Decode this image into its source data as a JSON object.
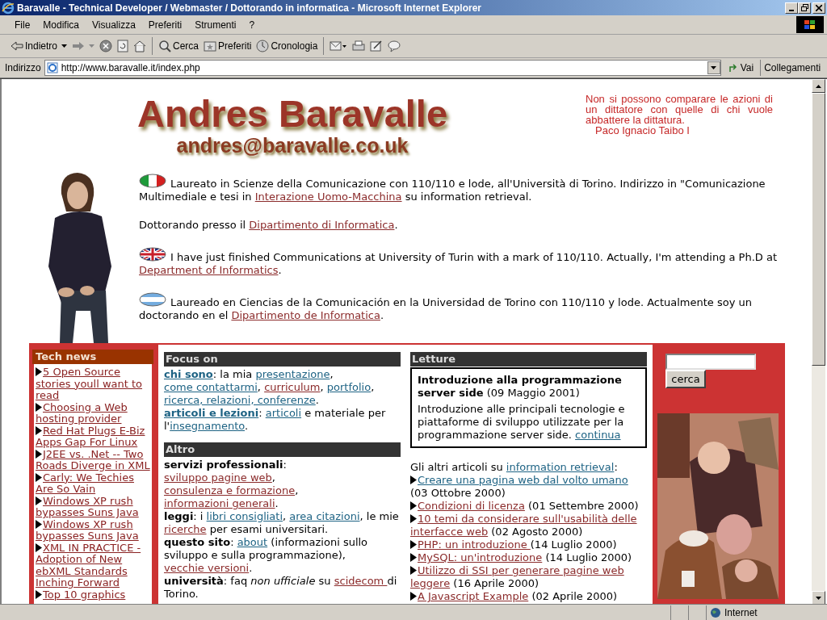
{
  "window": {
    "title": "Baravalle - Technical Developer / Webmaster / Dottorando in informatica - Microsoft Internet Explorer"
  },
  "menu": [
    "File",
    "Modifica",
    "Visualizza",
    "Preferiti",
    "Strumenti",
    "?"
  ],
  "toolbar": [
    {
      "kind": "back",
      "label": "Indietro"
    },
    {
      "kind": "forward"
    },
    {
      "kind": "stop"
    },
    {
      "kind": "refresh"
    },
    {
      "kind": "home"
    },
    {
      "kind": "search",
      "label": "Cerca"
    },
    {
      "kind": "favorites",
      "label": "Preferiti"
    },
    {
      "kind": "history",
      "label": "Cronologia"
    },
    {
      "kind": "mail"
    },
    {
      "kind": "print"
    },
    {
      "kind": "edit"
    },
    {
      "kind": "discuss"
    }
  ],
  "address_bar": {
    "label": "Indirizzo",
    "value": "http://www.baravalle.it/index.php",
    "go": "Vai",
    "links": "Collegamenti"
  },
  "header": {
    "name": "Andres Baravalle",
    "email": "andres@baravalle.co.uk",
    "quote": "Non si possono comparare le azioni di un dittatore  con quelle di chi  vuole abbattere la dittatura.",
    "quote_author": "Paco Ignacio Taibo I"
  },
  "bio": [
    {
      "kind": "italy",
      "segments": [
        {
          "kind": "text",
          "text": "Laureato in Scienze della Comunicazione con 110/110 e lode, all'Università di Torino. Indirizzo in \"Comunicazione Multimediale e tesi in "
        },
        {
          "kind": "link",
          "text": "Interazione Uomo-Macchina",
          "color": "#8b2b2b"
        },
        {
          "kind": "text",
          "text": " su information retrieval."
        }
      ]
    },
    {
      "segments": [
        {
          "kind": "text",
          "text": "Dottorando presso il "
        },
        {
          "kind": "link",
          "text": "Dipartimento di Informatica",
          "color": "#8b2b2b"
        },
        {
          "kind": "text",
          "text": "."
        }
      ]
    },
    {
      "kind": "uk",
      "segments": [
        {
          "kind": "text",
          "text": "I have just finished Communications at University of Turin with a mark of 110/110. Actually, I'm attending a Ph.D at "
        },
        {
          "kind": "link",
          "text": "Department of Informatics",
          "color": "#8b2b2b"
        },
        {
          "kind": "text",
          "text": "."
        }
      ]
    },
    {
      "kind": "argentina",
      "segments": [
        {
          "kind": "text",
          "text": "Laureado en Ciencias de la Comunicación en la Universidad de Torino con 110/110 y lode. Actualmente soy un doctorando en el "
        },
        {
          "kind": "link",
          "text": "Dipartimento de Informatica",
          "color": "#8b2b2b"
        },
        {
          "kind": "text",
          "text": "."
        }
      ]
    }
  ],
  "tech_news": {
    "title": "Tech news",
    "items": [
      "5 Open Source stories youll want to read",
      "Choosing a Web hosting provider",
      "Red Hat Plugs E-Biz Apps Gap For Linux",
      "J2EE vs. .Net -- Two Roads Diverge in XML",
      "Carly: We Techies Are So Vain",
      "Windows XP rush bypasses Suns Java",
      "Windows XP rush bypasses Suns Java",
      "XML IN PRACTICE - Adoption of New ebXML Standards Inching Forward",
      "Top 10 graphics"
    ]
  },
  "focus": {
    "title": "Focus on",
    "paragraphs": [
      [
        {
          "kind": "bold-link",
          "text": "chi sono",
          "color": "#1e6384"
        },
        {
          "kind": "text",
          "text": ": la mia "
        },
        {
          "kind": "link",
          "text": "presentazione",
          "color": "#1e6384"
        },
        {
          "kind": "text",
          "text": ", "
        },
        {
          "kind": "link",
          "text": "come contattarmi",
          "color": "#1e6384"
        },
        {
          "kind": "text",
          "text": ", "
        },
        {
          "kind": "link",
          "text": "curriculum",
          "color": "#8b2b2b"
        },
        {
          "kind": "text",
          "text": ", "
        },
        {
          "kind": "link",
          "text": "portfolio",
          "color": "#1e6384"
        },
        {
          "kind": "text",
          "text": ", "
        },
        {
          "kind": "link",
          "text": "ricerca, relazioni, conferenze",
          "color": "#1e6384"
        },
        {
          "kind": "text",
          "text": "."
        }
      ],
      [
        {
          "kind": "bold-link",
          "text": "articoli e lezioni",
          "color": "#1e6384"
        },
        {
          "kind": "text",
          "text": ": "
        },
        {
          "kind": "link",
          "text": "articoli",
          "color": "#1e6384"
        },
        {
          "kind": "text",
          "text": " e materiale per l'"
        },
        {
          "kind": "link",
          "text": "insegnamento",
          "color": "#1e6384"
        },
        {
          "kind": "text",
          "text": "."
        }
      ]
    ]
  },
  "altro": {
    "title": "Altro",
    "paragraphs": [
      [
        {
          "kind": "bold",
          "text": "servizi professionali"
        },
        {
          "kind": "text",
          "text": ": "
        },
        {
          "kind": "link",
          "text": "sviluppo pagine web",
          "color": "#8b2b2b"
        },
        {
          "kind": "text",
          "text": ", "
        },
        {
          "kind": "link",
          "text": "consulenza e formazione",
          "color": "#8b2b2b"
        },
        {
          "kind": "text",
          "text": ", "
        },
        {
          "kind": "link",
          "text": "informazioni generali",
          "color": "#8b2b2b"
        },
        {
          "kind": "text",
          "text": "."
        }
      ],
      [
        {
          "kind": "bold",
          "text": "leggi"
        },
        {
          "kind": "text",
          "text": ": i "
        },
        {
          "kind": "link",
          "text": "libri consigliati",
          "color": "#1e6384"
        },
        {
          "kind": "text",
          "text": ", "
        },
        {
          "kind": "link",
          "text": "area citazioni",
          "color": "#1e6384"
        },
        {
          "kind": "text",
          "text": ", le mie "
        },
        {
          "kind": "link",
          "text": "ricerche",
          "color": "#8b2b2b"
        },
        {
          "kind": "text",
          "text": " per esami universitari."
        }
      ],
      [
        {
          "kind": "bold",
          "text": "questo sito"
        },
        {
          "kind": "text",
          "text": ": "
        },
        {
          "kind": "link",
          "text": "about",
          "color": "#1e6384"
        },
        {
          "kind": "text",
          "text": " (informazioni sullo sviluppo e sulla programmazione), "
        },
        {
          "kind": "link",
          "text": "vecchie versioni",
          "color": "#8b2b2b"
        },
        {
          "kind": "text",
          "text": "."
        }
      ],
      [
        {
          "kind": "bold",
          "text": "università"
        },
        {
          "kind": "text",
          "text": ": faq "
        },
        {
          "kind": "italic",
          "text": "non ufficiale"
        },
        {
          "kind": "text",
          "text": " su "
        },
        {
          "kind": "link",
          "text": "scidecom ",
          "color": "#8b2b2b"
        },
        {
          "kind": "text",
          "text": "di Torino."
        }
      ]
    ]
  },
  "letture": {
    "title": "Letture",
    "featured": {
      "title": "Introduzione alla programmazione server side",
      "date": " (09 Maggio 2001)",
      "text": "Introduzione alle principali tecnologie e piattaforme di sviluppo utilizzate per la programmazione server side. ",
      "link": "continua"
    },
    "intro": [
      {
        "kind": "text",
        "text": "Gli altri articoli su "
      },
      {
        "kind": "link",
        "text": "information retrieval",
        "color": "#1e6384"
      },
      {
        "kind": "text",
        "text": ":"
      }
    ],
    "articles": [
      {
        "link": "Creare una pagina web dal volto umano",
        "color": "#1e6384",
        "date": " (03 Ottobre 2000)"
      },
      {
        "link": "Condizioni di licenza",
        "color": "#8b2b2b",
        "date": " (01 Settembre 2000)"
      },
      {
        "link": "10 temi da considerare sull'usabilità delle interfacce web",
        "color": "#8b2b2b",
        "date": " (02 Agosto 2000)"
      },
      {
        "link": "PHP: un introduzione ",
        "color": "#8b2b2b",
        "date": "(14 Luglio 2000)"
      },
      {
        "link": "MySQL: un'introduzione",
        "color": "#8b2b2b",
        "date": " (14 Luglio 2000)"
      },
      {
        "link": "Utilizzo di SSI per generare pagine web leggere",
        "color": "#8b2b2b",
        "date": " (16 Aprile 2000)"
      },
      {
        "link": "A Javascript Example",
        "color": "#8b2b2b",
        "date": " (02 Aprile 2000)"
      }
    ]
  },
  "search": {
    "button": "cerca"
  },
  "status_bar": {
    "zone": "Internet"
  }
}
